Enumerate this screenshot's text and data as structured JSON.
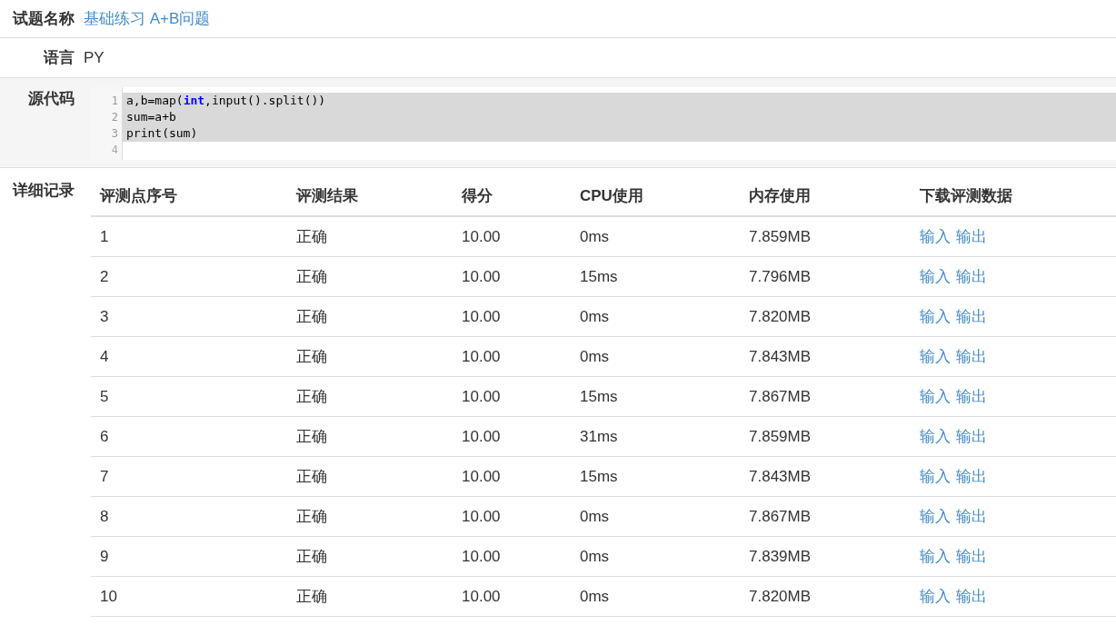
{
  "problem_name": {
    "label": "试题名称",
    "value": "基础练习 A+B问题"
  },
  "language": {
    "label": "语言",
    "value": "PY"
  },
  "source": {
    "label": "源代码",
    "lines": [
      {
        "number": "1",
        "selected": true,
        "tokens": [
          {
            "kind": "plain",
            "text": "a,b=map("
          },
          {
            "kind": "keyword",
            "text": "int"
          },
          {
            "kind": "plain",
            "text": ",input().split())"
          }
        ]
      },
      {
        "number": "2",
        "selected": true,
        "tokens": [
          {
            "kind": "plain",
            "text": "sum=a+b"
          }
        ]
      },
      {
        "number": "3",
        "selected": true,
        "tokens": [
          {
            "kind": "plain",
            "text": "print(sum)"
          }
        ]
      },
      {
        "number": "4",
        "selected": false
      }
    ]
  },
  "details": {
    "label": "详细记录",
    "columns": [
      "评测点序号",
      "评测结果",
      "得分",
      "CPU使用",
      "内存使用",
      "下载评测数据"
    ],
    "rows": [
      {
        "index": "1",
        "result": "正确",
        "score": "10.00",
        "cpu": "0ms",
        "memory": "7.859MB",
        "links": [
          "输入",
          "输出"
        ]
      },
      {
        "index": "2",
        "result": "正确",
        "score": "10.00",
        "cpu": "15ms",
        "memory": "7.796MB",
        "links": [
          "输入",
          "输出"
        ]
      },
      {
        "index": "3",
        "result": "正确",
        "score": "10.00",
        "cpu": "0ms",
        "memory": "7.820MB",
        "links": [
          "输入",
          "输出"
        ]
      },
      {
        "index": "4",
        "result": "正确",
        "score": "10.00",
        "cpu": "0ms",
        "memory": "7.843MB",
        "links": [
          "输入",
          "输出"
        ]
      },
      {
        "index": "5",
        "result": "正确",
        "score": "10.00",
        "cpu": "15ms",
        "memory": "7.867MB",
        "links": [
          "输入",
          "输出"
        ]
      },
      {
        "index": "6",
        "result": "正确",
        "score": "10.00",
        "cpu": "31ms",
        "memory": "7.859MB",
        "links": [
          "输入",
          "输出"
        ]
      },
      {
        "index": "7",
        "result": "正确",
        "score": "10.00",
        "cpu": "15ms",
        "memory": "7.843MB",
        "links": [
          "输入",
          "输出"
        ]
      },
      {
        "index": "8",
        "result": "正确",
        "score": "10.00",
        "cpu": "0ms",
        "memory": "7.867MB",
        "links": [
          "输入",
          "输出"
        ]
      },
      {
        "index": "9",
        "result": "正确",
        "score": "10.00",
        "cpu": "0ms",
        "memory": "7.839MB",
        "links": [
          "输入",
          "输出"
        ]
      },
      {
        "index": "10",
        "result": "正确",
        "score": "10.00",
        "cpu": "0ms",
        "memory": "7.820MB",
        "links": [
          "输入",
          "输出"
        ]
      }
    ]
  }
}
